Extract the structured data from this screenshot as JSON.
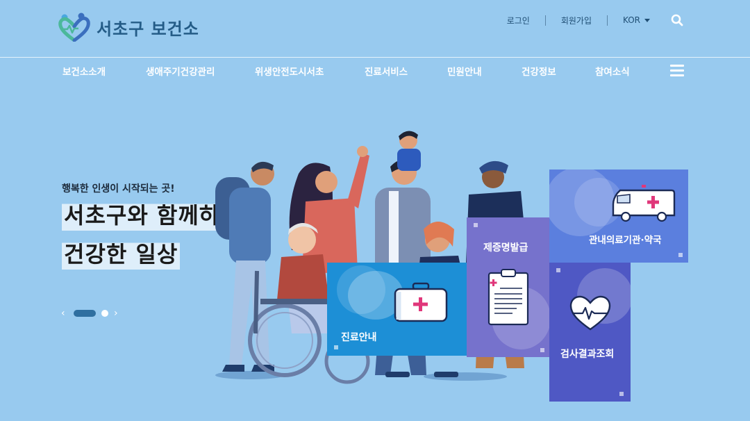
{
  "header": {
    "logo_text": "서초구 보건소",
    "util": {
      "login": "로그인",
      "signup": "회원가입",
      "lang": "KOR"
    }
  },
  "nav": {
    "items": [
      "보건소소개",
      "생애주기건강관리",
      "위생안전도시서초",
      "진료서비스",
      "민원안내",
      "건강정보",
      "참여소식"
    ]
  },
  "hero": {
    "subtitle": "행복한 인생이 시작되는 곳!",
    "title_line1": "서초구와 함께하는",
    "title_line2": "건강한 일상",
    "slide_current": 1,
    "slide_total": 2
  },
  "tiles": {
    "clinic": "진료안내",
    "certificate": "제증명발급",
    "institutions": "관내의료기관·약국",
    "results": "검사결과조회"
  },
  "colors": {
    "background": "#98caef",
    "tile_clinic": "#1d8fd6",
    "tile_certificate": "#7672cc",
    "tile_institutions": "#5b7fde",
    "tile_results": "#4f58c4"
  }
}
